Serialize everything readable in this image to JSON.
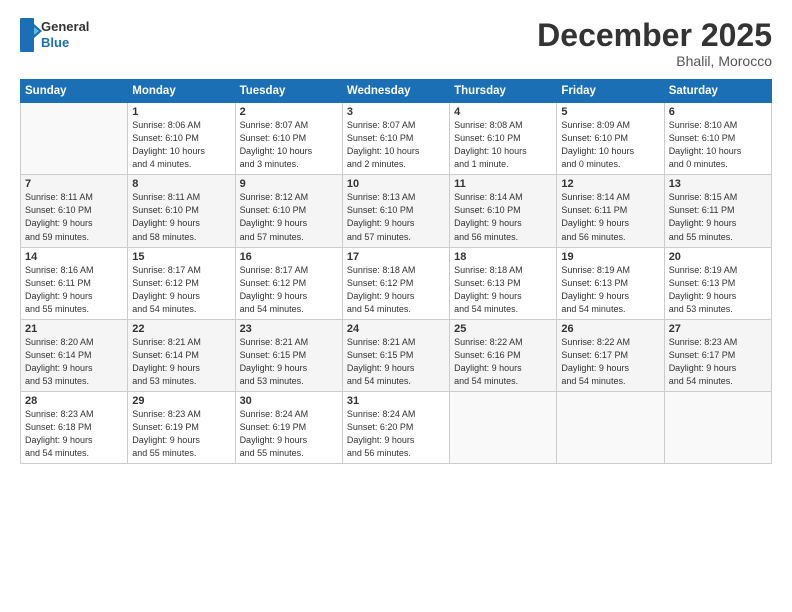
{
  "logo": {
    "general": "General",
    "blue": "Blue"
  },
  "title": "December 2025",
  "location": "Bhalil, Morocco",
  "days_header": [
    "Sunday",
    "Monday",
    "Tuesday",
    "Wednesday",
    "Thursday",
    "Friday",
    "Saturday"
  ],
  "weeks": [
    [
      {
        "day": "",
        "info": ""
      },
      {
        "day": "1",
        "info": "Sunrise: 8:06 AM\nSunset: 6:10 PM\nDaylight: 10 hours\nand 4 minutes."
      },
      {
        "day": "2",
        "info": "Sunrise: 8:07 AM\nSunset: 6:10 PM\nDaylight: 10 hours\nand 3 minutes."
      },
      {
        "day": "3",
        "info": "Sunrise: 8:07 AM\nSunset: 6:10 PM\nDaylight: 10 hours\nand 2 minutes."
      },
      {
        "day": "4",
        "info": "Sunrise: 8:08 AM\nSunset: 6:10 PM\nDaylight: 10 hours\nand 1 minute."
      },
      {
        "day": "5",
        "info": "Sunrise: 8:09 AM\nSunset: 6:10 PM\nDaylight: 10 hours\nand 0 minutes."
      },
      {
        "day": "6",
        "info": "Sunrise: 8:10 AM\nSunset: 6:10 PM\nDaylight: 10 hours\nand 0 minutes."
      }
    ],
    [
      {
        "day": "7",
        "info": "Sunrise: 8:11 AM\nSunset: 6:10 PM\nDaylight: 9 hours\nand 59 minutes."
      },
      {
        "day": "8",
        "info": "Sunrise: 8:11 AM\nSunset: 6:10 PM\nDaylight: 9 hours\nand 58 minutes."
      },
      {
        "day": "9",
        "info": "Sunrise: 8:12 AM\nSunset: 6:10 PM\nDaylight: 9 hours\nand 57 minutes."
      },
      {
        "day": "10",
        "info": "Sunrise: 8:13 AM\nSunset: 6:10 PM\nDaylight: 9 hours\nand 57 minutes."
      },
      {
        "day": "11",
        "info": "Sunrise: 8:14 AM\nSunset: 6:10 PM\nDaylight: 9 hours\nand 56 minutes."
      },
      {
        "day": "12",
        "info": "Sunrise: 8:14 AM\nSunset: 6:11 PM\nDaylight: 9 hours\nand 56 minutes."
      },
      {
        "day": "13",
        "info": "Sunrise: 8:15 AM\nSunset: 6:11 PM\nDaylight: 9 hours\nand 55 minutes."
      }
    ],
    [
      {
        "day": "14",
        "info": "Sunrise: 8:16 AM\nSunset: 6:11 PM\nDaylight: 9 hours\nand 55 minutes."
      },
      {
        "day": "15",
        "info": "Sunrise: 8:17 AM\nSunset: 6:12 PM\nDaylight: 9 hours\nand 54 minutes."
      },
      {
        "day": "16",
        "info": "Sunrise: 8:17 AM\nSunset: 6:12 PM\nDaylight: 9 hours\nand 54 minutes."
      },
      {
        "day": "17",
        "info": "Sunrise: 8:18 AM\nSunset: 6:12 PM\nDaylight: 9 hours\nand 54 minutes."
      },
      {
        "day": "18",
        "info": "Sunrise: 8:18 AM\nSunset: 6:13 PM\nDaylight: 9 hours\nand 54 minutes."
      },
      {
        "day": "19",
        "info": "Sunrise: 8:19 AM\nSunset: 6:13 PM\nDaylight: 9 hours\nand 54 minutes."
      },
      {
        "day": "20",
        "info": "Sunrise: 8:19 AM\nSunset: 6:13 PM\nDaylight: 9 hours\nand 53 minutes."
      }
    ],
    [
      {
        "day": "21",
        "info": "Sunrise: 8:20 AM\nSunset: 6:14 PM\nDaylight: 9 hours\nand 53 minutes."
      },
      {
        "day": "22",
        "info": "Sunrise: 8:21 AM\nSunset: 6:14 PM\nDaylight: 9 hours\nand 53 minutes."
      },
      {
        "day": "23",
        "info": "Sunrise: 8:21 AM\nSunset: 6:15 PM\nDaylight: 9 hours\nand 53 minutes."
      },
      {
        "day": "24",
        "info": "Sunrise: 8:21 AM\nSunset: 6:15 PM\nDaylight: 9 hours\nand 54 minutes."
      },
      {
        "day": "25",
        "info": "Sunrise: 8:22 AM\nSunset: 6:16 PM\nDaylight: 9 hours\nand 54 minutes."
      },
      {
        "day": "26",
        "info": "Sunrise: 8:22 AM\nSunset: 6:17 PM\nDaylight: 9 hours\nand 54 minutes."
      },
      {
        "day": "27",
        "info": "Sunrise: 8:23 AM\nSunset: 6:17 PM\nDaylight: 9 hours\nand 54 minutes."
      }
    ],
    [
      {
        "day": "28",
        "info": "Sunrise: 8:23 AM\nSunset: 6:18 PM\nDaylight: 9 hours\nand 54 minutes."
      },
      {
        "day": "29",
        "info": "Sunrise: 8:23 AM\nSunset: 6:19 PM\nDaylight: 9 hours\nand 55 minutes."
      },
      {
        "day": "30",
        "info": "Sunrise: 8:24 AM\nSunset: 6:19 PM\nDaylight: 9 hours\nand 55 minutes."
      },
      {
        "day": "31",
        "info": "Sunrise: 8:24 AM\nSunset: 6:20 PM\nDaylight: 9 hours\nand 56 minutes."
      },
      {
        "day": "",
        "info": ""
      },
      {
        "day": "",
        "info": ""
      },
      {
        "day": "",
        "info": ""
      }
    ]
  ]
}
